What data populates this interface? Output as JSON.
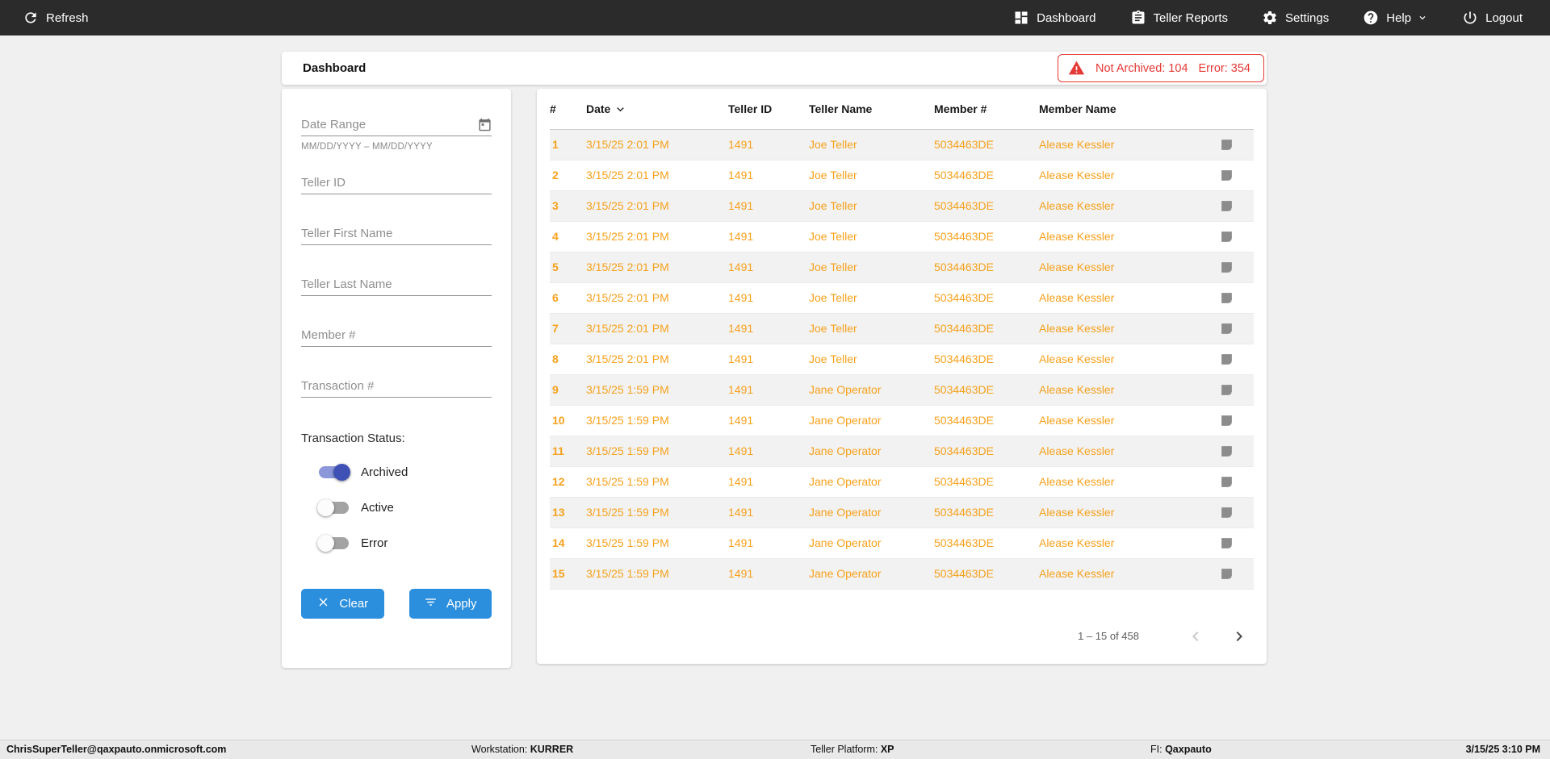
{
  "colors": {
    "navbar_bg": "#2b2b2b",
    "accent_blue": "#2b8fde",
    "data_orange": "#f7a11c",
    "error_red": "#e53935",
    "toggle_on_indigo": "#3f51b5"
  },
  "navbar": {
    "refresh_label": "Refresh",
    "items": [
      {
        "label": "Dashboard",
        "icon": "dashboard-icon"
      },
      {
        "label": "Teller Reports",
        "icon": "reports-icon"
      },
      {
        "label": "Settings",
        "icon": "settings-icon"
      },
      {
        "label": "Help",
        "icon": "help-icon",
        "has_chevron": true
      },
      {
        "label": "Logout",
        "icon": "logout-icon"
      }
    ]
  },
  "header": {
    "title": "Dashboard",
    "alert": {
      "not_archived": "Not Archived: 104",
      "error": "Error: 354"
    }
  },
  "filters": {
    "date_range": {
      "placeholder": "Date Range",
      "hint": "MM/DD/YYYY – MM/DD/YYYY"
    },
    "fields": [
      "Teller ID",
      "Teller First Name",
      "Teller Last Name",
      "Member #",
      "Transaction #"
    ],
    "status_label": "Transaction Status:",
    "status_toggles": [
      {
        "label": "Archived",
        "on": true
      },
      {
        "label": "Active",
        "on": false
      },
      {
        "label": "Error",
        "on": false
      }
    ],
    "clear_label": "Clear",
    "apply_label": "Apply"
  },
  "table": {
    "columns": [
      "#",
      "Date",
      "Teller ID",
      "Teller Name",
      "Member #",
      "Member Name"
    ],
    "sort_column": "Date",
    "rows": [
      {
        "num": "1",
        "date": "3/15/25 2:01 PM",
        "teller_id": "1491",
        "teller_name": "Joe Teller",
        "member_num": "5034463DE",
        "member_name": "Alease Kessler"
      },
      {
        "num": "2",
        "date": "3/15/25 2:01 PM",
        "teller_id": "1491",
        "teller_name": "Joe Teller",
        "member_num": "5034463DE",
        "member_name": "Alease Kessler"
      },
      {
        "num": "3",
        "date": "3/15/25 2:01 PM",
        "teller_id": "1491",
        "teller_name": "Joe Teller",
        "member_num": "5034463DE",
        "member_name": "Alease Kessler"
      },
      {
        "num": "4",
        "date": "3/15/25 2:01 PM",
        "teller_id": "1491",
        "teller_name": "Joe Teller",
        "member_num": "5034463DE",
        "member_name": "Alease Kessler"
      },
      {
        "num": "5",
        "date": "3/15/25 2:01 PM",
        "teller_id": "1491",
        "teller_name": "Joe Teller",
        "member_num": "5034463DE",
        "member_name": "Alease Kessler"
      },
      {
        "num": "6",
        "date": "3/15/25 2:01 PM",
        "teller_id": "1491",
        "teller_name": "Joe Teller",
        "member_num": "5034463DE",
        "member_name": "Alease Kessler"
      },
      {
        "num": "7",
        "date": "3/15/25 2:01 PM",
        "teller_id": "1491",
        "teller_name": "Joe Teller",
        "member_num": "5034463DE",
        "member_name": "Alease Kessler"
      },
      {
        "num": "8",
        "date": "3/15/25 2:01 PM",
        "teller_id": "1491",
        "teller_name": "Joe Teller",
        "member_num": "5034463DE",
        "member_name": "Alease Kessler"
      },
      {
        "num": "9",
        "date": "3/15/25 1:59 PM",
        "teller_id": "1491",
        "teller_name": "Jane Operator",
        "member_num": "5034463DE",
        "member_name": "Alease Kessler"
      },
      {
        "num": "10",
        "date": "3/15/25 1:59 PM",
        "teller_id": "1491",
        "teller_name": "Jane Operator",
        "member_num": "5034463DE",
        "member_name": "Alease Kessler"
      },
      {
        "num": "11",
        "date": "3/15/25 1:59 PM",
        "teller_id": "1491",
        "teller_name": "Jane Operator",
        "member_num": "5034463DE",
        "member_name": "Alease Kessler"
      },
      {
        "num": "12",
        "date": "3/15/25 1:59 PM",
        "teller_id": "1491",
        "teller_name": "Jane Operator",
        "member_num": "5034463DE",
        "member_name": "Alease Kessler"
      },
      {
        "num": "13",
        "date": "3/15/25 1:59 PM",
        "teller_id": "1491",
        "teller_name": "Jane Operator",
        "member_num": "5034463DE",
        "member_name": "Alease Kessler"
      },
      {
        "num": "14",
        "date": "3/15/25 1:59 PM",
        "teller_id": "1491",
        "teller_name": "Jane Operator",
        "member_num": "5034463DE",
        "member_name": "Alease Kessler"
      },
      {
        "num": "15",
        "date": "3/15/25 1:59 PM",
        "teller_id": "1491",
        "teller_name": "Jane Operator",
        "member_num": "5034463DE",
        "member_name": "Alease Kessler"
      }
    ],
    "pagination": {
      "range": "1 – 15 of 458"
    }
  },
  "footer": {
    "user": "ChrisSuperTeller@qaxpauto.onmicrosoft.com",
    "workstation_label": "Workstation: ",
    "workstation": "KURRER",
    "platform_label": "Teller Platform: ",
    "platform": "XP",
    "fi_label": "FI: ",
    "fi": "Qaxpauto",
    "datetime": "3/15/25 3:10 PM"
  }
}
